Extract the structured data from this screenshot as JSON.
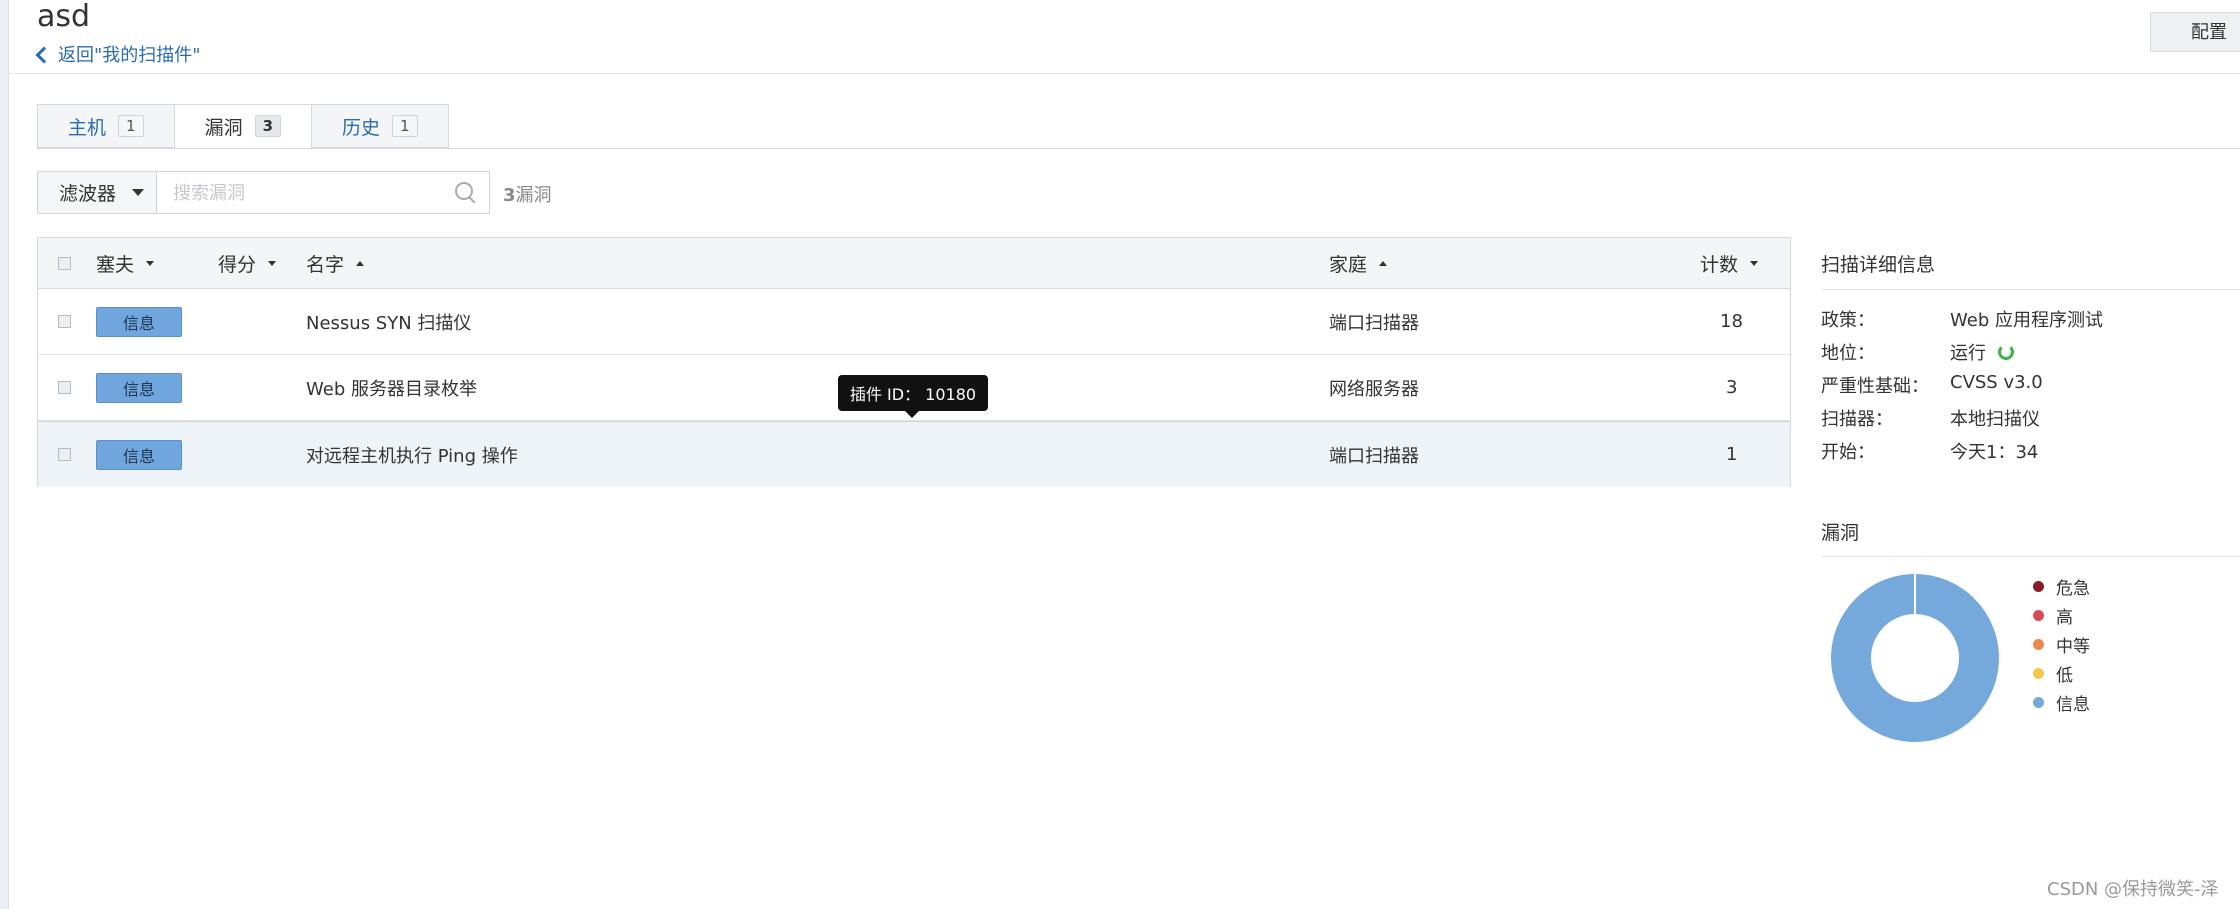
{
  "header": {
    "title": "asd",
    "back_label": "返回\"我的扫描件\"",
    "config_label": "配置"
  },
  "tabs": [
    {
      "label": "主机",
      "count": "1"
    },
    {
      "label": "漏洞",
      "count": "3"
    },
    {
      "label": "历史",
      "count": "1"
    }
  ],
  "toolbar": {
    "filter_label": "滤波器",
    "search_placeholder": "搜索漏洞",
    "count_prefix": "3",
    "count_label": "漏洞"
  },
  "table": {
    "columns": {
      "severity": "塞夫",
      "score": "得分",
      "name": "名字",
      "family": "家庭",
      "count": "计数"
    },
    "rows": [
      {
        "severity": "信息",
        "name": "Nessus SYN 扫描仪",
        "family": "端口扫描器",
        "count": "18"
      },
      {
        "severity": "信息",
        "name": "Web 服务器目录枚举",
        "family": "网络服务器",
        "count": "3"
      },
      {
        "severity": "信息",
        "name": "对远程主机执行 Ping 操作",
        "family": "端口扫描器",
        "count": "1"
      }
    ]
  },
  "tooltip": "插件 ID： 10180",
  "scan_details": {
    "title": "扫描详细信息",
    "items": [
      {
        "label": "政策：",
        "value": "Web 应用程序测试"
      },
      {
        "label": "地位：",
        "value": "运行"
      },
      {
        "label": "严重性基础：",
        "value": "CVSS v3.0"
      },
      {
        "label": "扫描器：",
        "value": "本地扫描仪"
      },
      {
        "label": "开始：",
        "value": "今天1：34"
      }
    ]
  },
  "vulnerabilities": {
    "title": "漏洞",
    "legend": [
      {
        "label": "危急",
        "color": "#8b1a2b"
      },
      {
        "label": "高",
        "color": "#d24d57"
      },
      {
        "label": "中等",
        "color": "#ea8a4f"
      },
      {
        "label": "低",
        "color": "#f2c94c"
      },
      {
        "label": "信息",
        "color": "#75a9dc"
      }
    ],
    "chart_data": {
      "type": "pie",
      "categories": [
        "危急",
        "高",
        "中等",
        "低",
        "信息"
      ],
      "values": [
        0,
        0,
        0,
        0,
        3
      ]
    }
  },
  "watermark": "CSDN @保持微笑-泽"
}
